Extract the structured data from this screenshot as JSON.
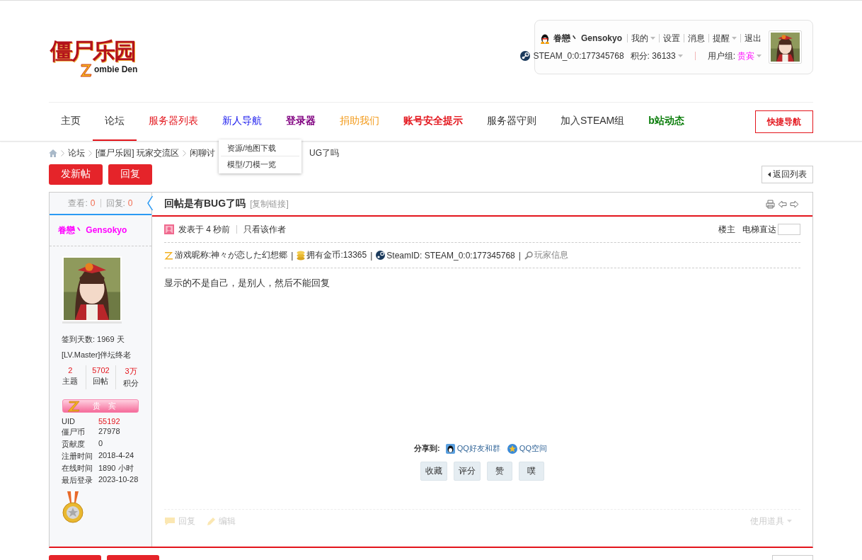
{
  "header": {
    "logo": {
      "title": "僵尸乐园",
      "subtitle": "ombie Den"
    },
    "user": {
      "name": "眷戀丶 Gensokyo",
      "links": [
        {
          "label": "我的",
          "dropdown": true
        },
        {
          "label": "设置",
          "dropdown": false
        },
        {
          "label": "消息",
          "dropdown": false
        },
        {
          "label": "提醒",
          "dropdown": true
        },
        {
          "label": "退出",
          "dropdown": false
        }
      ],
      "steam_id": "STEAM_0:0:177345768",
      "points": "积分: 36133",
      "group_label": "用户组:",
      "group": "贵宾"
    }
  },
  "nav": {
    "items": [
      {
        "label": "主页",
        "selected": false,
        "color": "#333333",
        "bold": false
      },
      {
        "label": "论坛",
        "selected": true,
        "color": "#333333",
        "bold": false
      },
      {
        "label": "服务器列表",
        "selected": false,
        "color": "#e3151c",
        "bold": false
      },
      {
        "label": "新人导航",
        "selected": false,
        "color": "#1a1aee",
        "bold": false
      },
      {
        "label": "登录器",
        "selected": false,
        "color": "#800080",
        "bold": true
      },
      {
        "label": "捐助我们",
        "selected": false,
        "color": "#f39a1a",
        "bold": false
      },
      {
        "label": "账号安全提示",
        "selected": false,
        "color": "#e3151c",
        "bold": true
      },
      {
        "label": "服务器守则",
        "selected": false,
        "color": "#333333",
        "bold": false
      },
      {
        "label": "加入STEAM组",
        "selected": false,
        "color": "#333333",
        "bold": false
      },
      {
        "label": "b站动态",
        "selected": false,
        "color": "#0a7d0a",
        "bold": true
      }
    ],
    "quick_button": "快捷导航",
    "dropdown": [
      "资源/地图下载",
      "模型/刀模一览"
    ]
  },
  "breadcrumb": [
    "论坛",
    "[僵尸乐园] 玩家交流区",
    "闲聊讨",
    "UG了吗"
  ],
  "actions": {
    "buttons": [
      "发新帖",
      "回复"
    ],
    "back": "返回列表"
  },
  "thread": {
    "views_label": "查看:",
    "views": "0",
    "replies_label": "回复:",
    "replies": "0",
    "title": "回帖是有BUG了吗",
    "copy_link": "[复制链接]"
  },
  "author": {
    "name": "眷戀丶 Gensokyo",
    "checkin": "签到天数: 1969 天",
    "level": "[LV.Master]伴坛终老",
    "stats": [
      {
        "value": "2",
        "label": "主题"
      },
      {
        "value": "5702",
        "label": "回帖"
      },
      {
        "value": "3万",
        "label": "积分"
      }
    ],
    "group_badge": "贵　宾",
    "info": [
      {
        "label": "UID",
        "value": "55192",
        "highlight": true
      },
      {
        "label": "僵尸币",
        "value": "27978",
        "highlight": false
      },
      {
        "label": "贡献度",
        "value": "0",
        "highlight": false
      },
      {
        "label": "注册时间",
        "value": "2018-4-24",
        "highlight": false
      },
      {
        "label": "在线时间",
        "value": "1890 小时",
        "highlight": false
      },
      {
        "label": "最后登录",
        "value": "2023-10-28",
        "highlight": false
      }
    ]
  },
  "post": {
    "posted": "发表于 4 秒前",
    "only_author": "只看该作者",
    "floor": "楼主",
    "jump_label": "电梯直达",
    "separator": "|",
    "info": [
      {
        "kind": "nickname",
        "text": "游戏昵称:神々が恋した幻想郷"
      },
      {
        "kind": "coins",
        "text": "拥有金币:13365"
      },
      {
        "kind": "steam",
        "text": "SteamID: STEAM_0:0:177345768"
      },
      {
        "kind": "profile",
        "text": "玩家信息"
      }
    ],
    "body": "显示的不是自己，是别人，然后不能回复",
    "share_label": "分享到:",
    "share": [
      {
        "kind": "friends",
        "label": "QQ好友和群"
      },
      {
        "kind": "zone",
        "label": "QQ空间"
      }
    ],
    "buttons": [
      "收藏",
      "评分",
      "赞",
      "噗"
    ],
    "footer": {
      "reply": "回复",
      "edit": "编辑",
      "tools": "使用道具"
    }
  },
  "bottom_actions": {
    "buttons": [
      {
        "kind": "post"
      },
      {
        "kind": "post"
      }
    ],
    "back": {
      "kind": "back"
    }
  }
}
